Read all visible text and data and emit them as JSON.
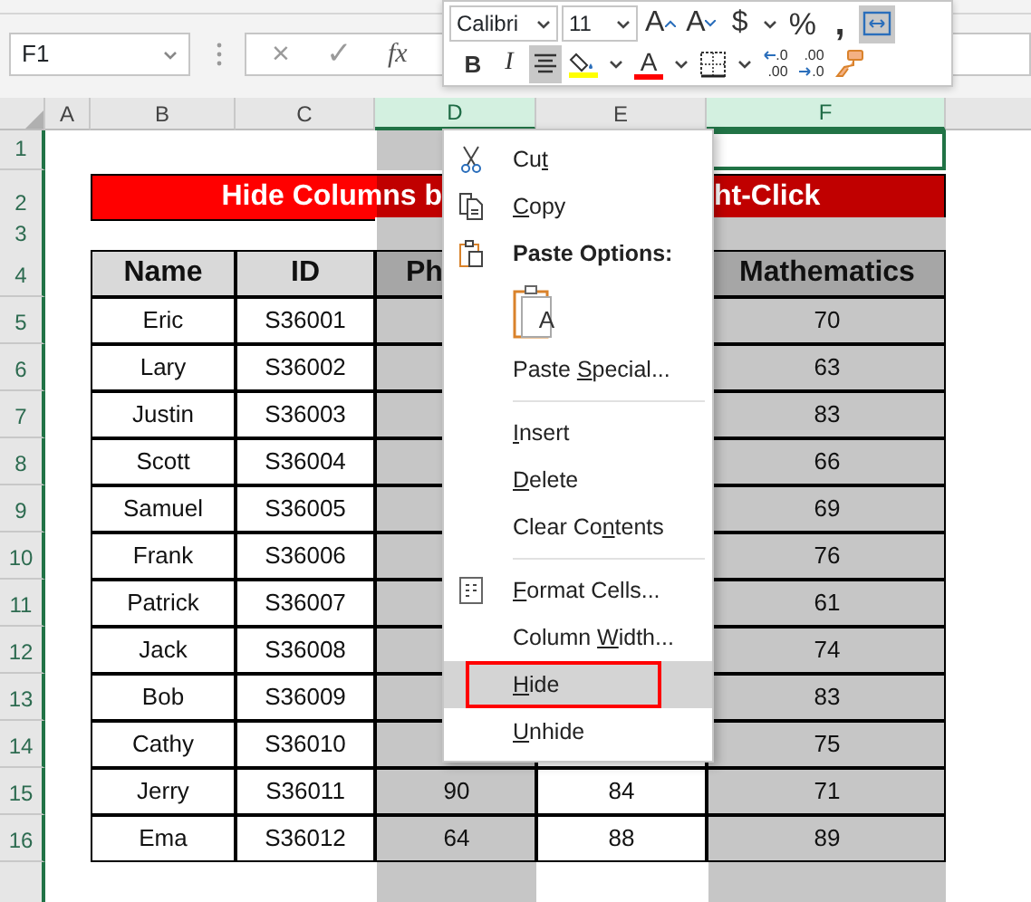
{
  "formula_bar": {
    "name_box": "F1",
    "cancel": "×",
    "enter": "✓",
    "function": "fx"
  },
  "mini_toolbar": {
    "font": "Calibri",
    "size": "11",
    "row_1": [
      {
        "kind": "grow-font",
        "glyph": "A",
        "selected": false
      },
      {
        "kind": "shrink-font",
        "glyph": "A",
        "selected": false
      },
      {
        "kind": "currency",
        "glyph": "$",
        "dropdown": true,
        "selected": false
      },
      {
        "kind": "percent",
        "glyph": "%",
        "selected": false
      },
      {
        "kind": "comma",
        "glyph": ",",
        "selected": false
      },
      {
        "kind": "wrap",
        "selected": true
      }
    ],
    "row_2": [
      {
        "kind": "bold",
        "glyph": "B",
        "selected": false
      },
      {
        "kind": "italic",
        "glyph": "I",
        "selected": false
      },
      {
        "kind": "center",
        "selected": true
      },
      {
        "kind": "fill-color",
        "color": "#ffff00",
        "dropdown": true,
        "selected": false
      },
      {
        "kind": "font-color",
        "glyph": "A",
        "color": "#ff0000",
        "dropdown": true,
        "selected": false
      },
      {
        "kind": "borders",
        "dropdown": true,
        "selected": false
      },
      {
        "kind": "increase-decimal",
        "lines": [
          ".0",
          ".00"
        ],
        "selected": false
      },
      {
        "kind": "decrease-decimal",
        "lines": [
          ".00",
          ".0"
        ],
        "selected": false
      },
      {
        "kind": "format-painter",
        "selected": false
      }
    ]
  },
  "columns": [
    {
      "label": "A",
      "selected": false,
      "active": false
    },
    {
      "label": "B",
      "selected": false,
      "active": false
    },
    {
      "label": "C",
      "selected": false,
      "active": false
    },
    {
      "label": "D",
      "selected": true,
      "active": false
    },
    {
      "label": "E",
      "selected": false,
      "active": false
    },
    {
      "label": "F",
      "selected": true,
      "active": true
    }
  ],
  "row_numbers": [
    "1",
    "2",
    "3",
    "4",
    "5",
    "6",
    "7",
    "8",
    "9",
    "10",
    "11",
    "12",
    "13",
    "14",
    "15",
    "16"
  ],
  "title": {
    "left": "Hide Columns b",
    "right": "ht-Click"
  },
  "table": {
    "header": {
      "name": "Name",
      "id": "ID",
      "col_d": "Ph",
      "mathematics": "Mathematics"
    },
    "rows": [
      {
        "name": "Eric",
        "id": "S36001",
        "mathematics": "70"
      },
      {
        "name": "Lary",
        "id": "S36002",
        "mathematics": "63"
      },
      {
        "name": "Justin",
        "id": "S36003",
        "mathematics": "83"
      },
      {
        "name": "Scott",
        "id": "S36004",
        "mathematics": "66"
      },
      {
        "name": "Samuel",
        "id": "S36005",
        "mathematics": "69"
      },
      {
        "name": "Frank",
        "id": "S36006",
        "mathematics": "76"
      },
      {
        "name": "Patrick",
        "id": "S36007",
        "mathematics": "61"
      },
      {
        "name": "Jack",
        "id": "S36008",
        "mathematics": "74"
      },
      {
        "name": "Bob",
        "id": "S36009",
        "mathematics": "83"
      },
      {
        "name": "Cathy",
        "id": "S36010",
        "mathematics": "75"
      },
      {
        "name": "Jerry",
        "id": "S36011",
        "col_d": "90",
        "col_e": "84",
        "mathematics": "71"
      },
      {
        "name": "Ema",
        "id": "S36012",
        "col_d": "64",
        "col_e": "88",
        "mathematics": "89"
      }
    ]
  },
  "context_menu": {
    "items": [
      {
        "kind": "cut",
        "pre": "Cu",
        "key": "t",
        "selected": false,
        "outlined": false
      },
      {
        "kind": "copy",
        "key": "C",
        "post": "opy",
        "selected": false,
        "outlined": false
      },
      {
        "kind": "header",
        "text": "Paste Options:"
      },
      {
        "kind": "paste-icons",
        "glyph": "A"
      },
      {
        "kind": "command",
        "pre": "Paste ",
        "key": "S",
        "post": "pecial...",
        "selected": false,
        "outlined": false
      },
      {
        "kind": "divider"
      },
      {
        "kind": "command",
        "key": "I",
        "post": "nsert",
        "selected": false,
        "outlined": false
      },
      {
        "kind": "command",
        "key": "D",
        "post": "elete",
        "selected": false,
        "outlined": false
      },
      {
        "kind": "command",
        "pre": "Clear Co",
        "key": "n",
        "post": "tents",
        "selected": false,
        "outlined": false
      },
      {
        "kind": "divider"
      },
      {
        "kind": "format-cells",
        "key": "F",
        "post": "ormat Cells...",
        "selected": false,
        "outlined": false
      },
      {
        "kind": "command",
        "pre": "Column ",
        "key": "W",
        "post": "idth...",
        "selected": false,
        "outlined": false
      },
      {
        "kind": "command",
        "key": "H",
        "post": "ide",
        "selected": true,
        "outlined": true
      },
      {
        "kind": "command",
        "key": "U",
        "post": "nhide",
        "selected": false,
        "outlined": false
      }
    ]
  }
}
